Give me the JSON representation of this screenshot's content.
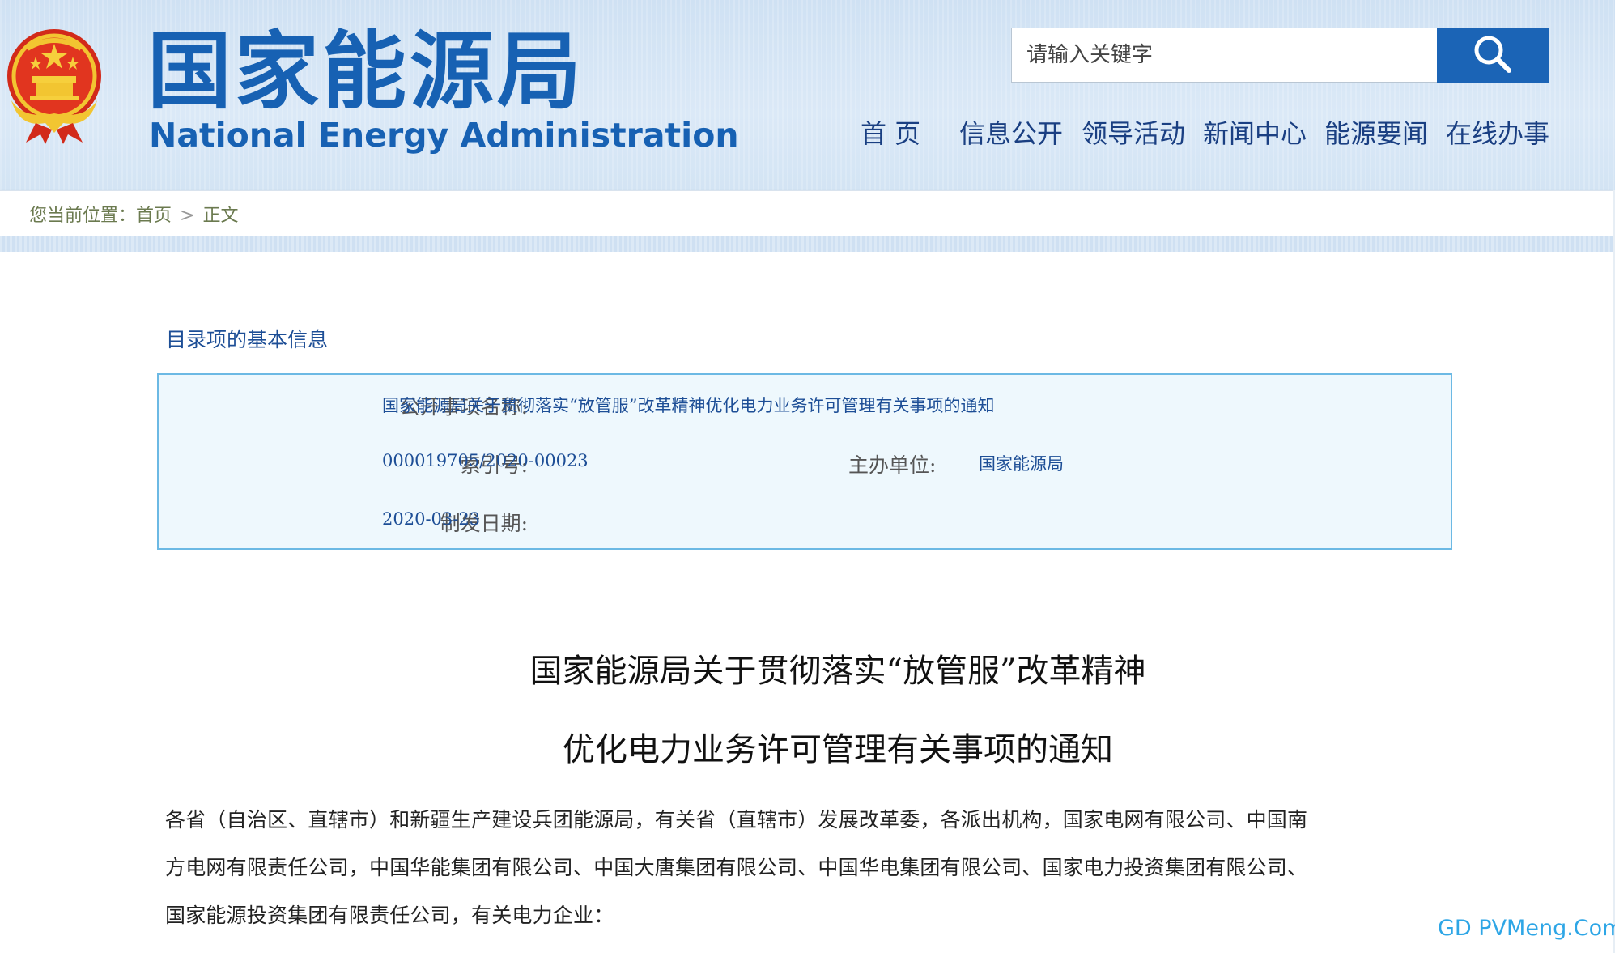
{
  "header": {
    "site_title": "国家能源局",
    "site_subtitle": "National Energy Administration",
    "search": {
      "placeholder": "请输入关键字"
    },
    "nav": [
      "首 页",
      "信息公开",
      "领导活动",
      "新闻中心",
      "能源要闻",
      "在线办事"
    ]
  },
  "breadcrumb": {
    "prefix": "您当前位置：",
    "home": "首页",
    "separator": ">",
    "current": "正文"
  },
  "info": {
    "heading": "目录项的基本信息",
    "name_label": "公开事项名称:",
    "name_value": "国家能源局关于贯彻落实“放管服”改革精神优化电力业务许可管理有关事项的通知",
    "index_label": "索引号:",
    "index_value": "000019705/2020-00023",
    "org_label": "主办单位:",
    "org_value": "国家能源局",
    "date_label": "制发日期:",
    "date_value": "2020-03-23"
  },
  "article": {
    "title_line1": "国家能源局关于贯彻落实“放管服”改革精神",
    "title_line2": "优化电力业务许可管理有关事项的通知",
    "paragraph_lines": [
      "各省（自治区、直辖市）和新疆生产建设兵团能源局，有关省（直辖市）发展改革委，各派出机构，国家电网有限公司、中国南",
      "方电网有限责任公司，中国华能集团有限公司、中国大唐集团有限公司、中国华电集团有限公司、国家电力投资集团有限公司、",
      "国家能源投资集团有限责任公司，有关电力企业："
    ]
  },
  "watermark": "GD PVMeng.Com",
  "colors": {
    "brand_blue": "#1761b3",
    "header_bg": "#d3e4f4",
    "search_button": "#1b64b6",
    "info_border": "#6cb9e4",
    "info_bg": "#eef8fd",
    "link_blue": "#1d4e96"
  },
  "icons": {
    "emblem": "national-emblem-icon",
    "search": "search-icon"
  }
}
